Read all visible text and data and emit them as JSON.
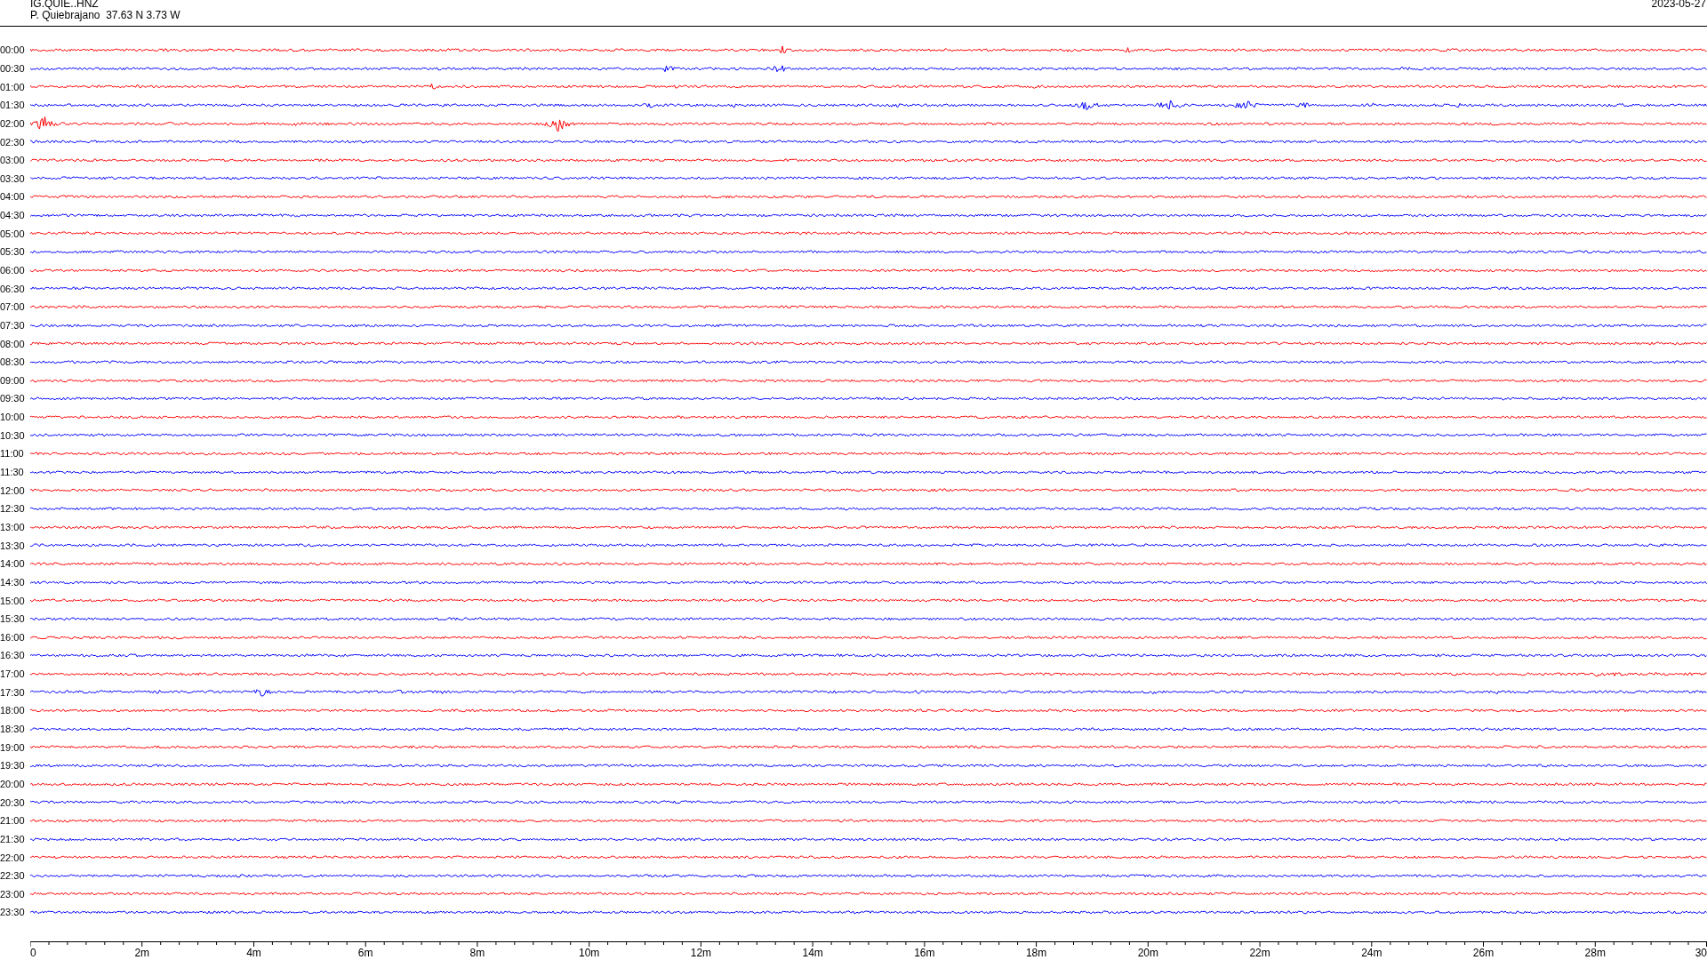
{
  "header": {
    "station": "IG.QUIE..HNZ",
    "location": "P. Quiebrajano  37.63 N 3.73 W",
    "date": "2023-05-27"
  },
  "traces": [
    {
      "label": "00:00",
      "color": "#ff0000"
    },
    {
      "label": "00:30",
      "color": "#0000ff"
    },
    {
      "label": "01:00",
      "color": "#ff0000"
    },
    {
      "label": "01:30",
      "color": "#0000ff"
    },
    {
      "label": "02:00",
      "color": "#ff0000"
    },
    {
      "label": "02:30",
      "color": "#0000ff"
    },
    {
      "label": "03:00",
      "color": "#ff0000"
    },
    {
      "label": "03:30",
      "color": "#0000ff"
    },
    {
      "label": "04:00",
      "color": "#ff0000"
    },
    {
      "label": "04:30",
      "color": "#0000ff"
    },
    {
      "label": "05:00",
      "color": "#ff0000"
    },
    {
      "label": "05:30",
      "color": "#0000ff"
    },
    {
      "label": "06:00",
      "color": "#ff0000"
    },
    {
      "label": "06:30",
      "color": "#0000ff"
    },
    {
      "label": "07:00",
      "color": "#ff0000"
    },
    {
      "label": "07:30",
      "color": "#0000ff"
    },
    {
      "label": "08:00",
      "color": "#ff0000"
    },
    {
      "label": "08:30",
      "color": "#0000ff"
    },
    {
      "label": "09:00",
      "color": "#ff0000"
    },
    {
      "label": "09:30",
      "color": "#0000ff"
    },
    {
      "label": "10:00",
      "color": "#ff0000"
    },
    {
      "label": "10:30",
      "color": "#0000ff"
    },
    {
      "label": "11:00",
      "color": "#ff0000"
    },
    {
      "label": "11:30",
      "color": "#0000ff"
    },
    {
      "label": "12:00",
      "color": "#ff0000"
    },
    {
      "label": "12:30",
      "color": "#0000ff"
    },
    {
      "label": "13:00",
      "color": "#ff0000"
    },
    {
      "label": "13:30",
      "color": "#0000ff"
    },
    {
      "label": "14:00",
      "color": "#ff0000"
    },
    {
      "label": "14:30",
      "color": "#0000ff"
    },
    {
      "label": "15:00",
      "color": "#ff0000"
    },
    {
      "label": "15:30",
      "color": "#0000ff"
    },
    {
      "label": "16:00",
      "color": "#ff0000"
    },
    {
      "label": "16:30",
      "color": "#0000ff"
    },
    {
      "label": "17:00",
      "color": "#ff0000"
    },
    {
      "label": "17:30",
      "color": "#0000ff"
    },
    {
      "label": "18:00",
      "color": "#ff0000"
    },
    {
      "label": "18:30",
      "color": "#0000ff"
    },
    {
      "label": "19:00",
      "color": "#ff0000"
    },
    {
      "label": "19:30",
      "color": "#0000ff"
    },
    {
      "label": "20:00",
      "color": "#ff0000"
    },
    {
      "label": "20:30",
      "color": "#0000ff"
    },
    {
      "label": "21:00",
      "color": "#ff0000"
    },
    {
      "label": "21:30",
      "color": "#0000ff"
    },
    {
      "label": "22:00",
      "color": "#ff0000"
    },
    {
      "label": "22:30",
      "color": "#0000ff"
    },
    {
      "label": "23:00",
      "color": "#ff0000"
    },
    {
      "label": "23:30",
      "color": "#0000ff"
    }
  ],
  "x_axis": {
    "ticks": [
      "0",
      "2m",
      "4m",
      "6m",
      "8m",
      "10m",
      "12m",
      "14m",
      "16m",
      "18m",
      "20m",
      "22m",
      "24m",
      "26m",
      "28m",
      "30"
    ]
  }
}
